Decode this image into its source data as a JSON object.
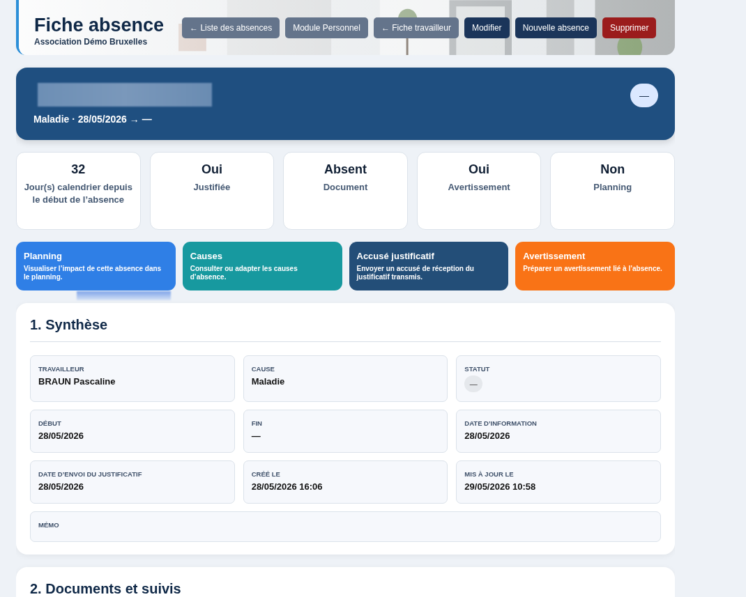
{
  "header": {
    "title": "Fiche absence",
    "subtitle": "Association Démo Bruxelles",
    "buttons": [
      {
        "label": "← Liste des absences",
        "kind": "secondary"
      },
      {
        "label": "Module Personnel",
        "kind": "secondary"
      },
      {
        "label": "← Fiche travailleur",
        "kind": "secondary"
      },
      {
        "label": "Modifier",
        "kind": "primary"
      },
      {
        "label": "Nouvelle absence",
        "kind": "primary"
      },
      {
        "label": "Supprimer",
        "kind": "danger"
      }
    ]
  },
  "hero": {
    "name_redacted": true,
    "subtitle": "Maladie · 28/05/2026 → —",
    "status_badge": "—"
  },
  "stats": [
    {
      "value": "32",
      "label": "Jour(s) calendrier depuis le début de l’absence"
    },
    {
      "value": "Oui",
      "label": "Justifiée"
    },
    {
      "value": "Absent",
      "label": "Document"
    },
    {
      "value": "Oui",
      "label": "Avertissement"
    },
    {
      "value": "Non",
      "label": "Planning"
    }
  ],
  "actions": [
    {
      "title": "Planning",
      "description": "Visualiser l’impact de cette absence dans le planning.",
      "color": "#2f7fe6"
    },
    {
      "title": "Causes",
      "description": "Consulter ou adapter les causes d’absence.",
      "color": "#17999f"
    },
    {
      "title": "Accusé justificatif",
      "description": "Envoyer un accusé de réception du justificatif transmis.",
      "color": "#234e78"
    },
    {
      "title": "Avertissement",
      "description": "Préparer un avertissement lié à l’absence.",
      "color": "#f97316"
    }
  ],
  "sections": [
    {
      "title": "1. Synthèse",
      "fields": [
        {
          "label": "TRAVAILLEUR",
          "value": "BRAUN Pascaline",
          "kind": "text"
        },
        {
          "label": "CAUSE",
          "value": "Maladie",
          "kind": "text"
        },
        {
          "label": "STATUT",
          "value": "—",
          "kind": "badge"
        },
        {
          "label": "DÉBUT",
          "value": "28/05/2026",
          "kind": "text"
        },
        {
          "label": "FIN",
          "value": "—",
          "kind": "text"
        },
        {
          "label": "DATE D’INFORMATION",
          "value": "28/05/2026",
          "kind": "text"
        },
        {
          "label": "DATE D’ENVOI DU JUSTIFICATIF",
          "value": "28/05/2026",
          "kind": "text"
        },
        {
          "label": "CRÉÉ LE",
          "value": "28/05/2026 16:06",
          "kind": "text"
        },
        {
          "label": "MIS À JOUR LE",
          "value": "29/05/2026 10:58",
          "kind": "text"
        },
        {
          "label": "MÉMO",
          "kind": "wide"
        }
      ]
    },
    {
      "title": "2. Documents et suivis"
    }
  ]
}
